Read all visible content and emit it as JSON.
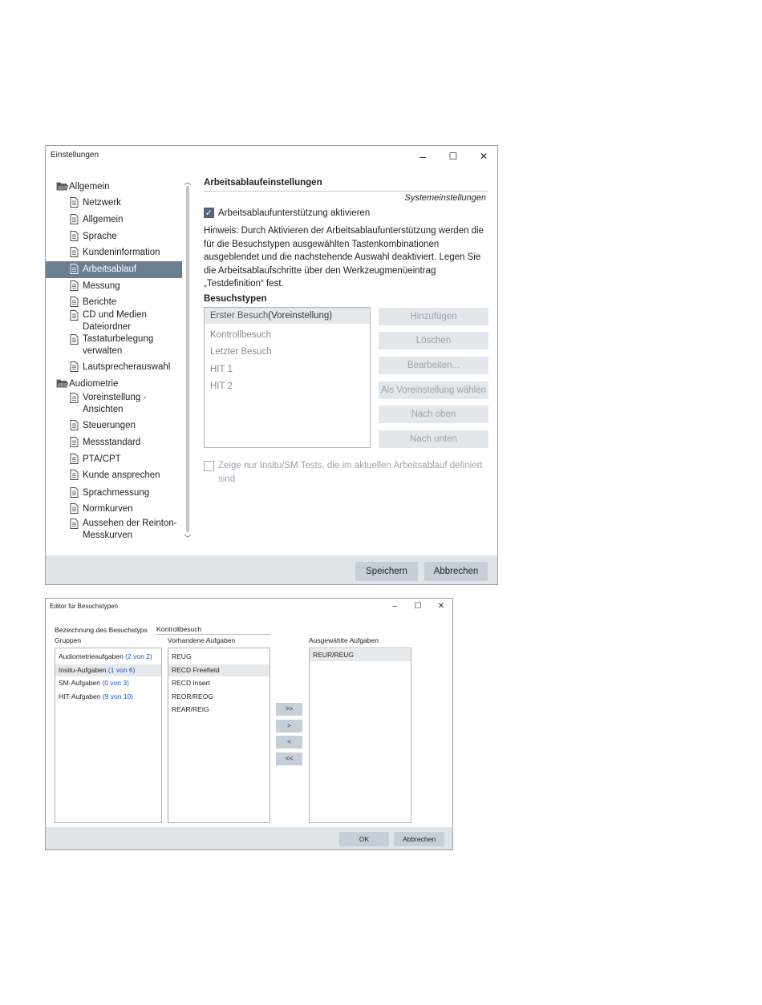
{
  "settings": {
    "title": "Einstellungen",
    "controls": {
      "minimize": "–",
      "maximize": "☐",
      "close": "✕"
    },
    "tree": [
      {
        "label": "Allgemein",
        "type": "folder",
        "depth": 0
      },
      {
        "label": "Netzwerk",
        "type": "page",
        "depth": 1
      },
      {
        "label": "Allgemein",
        "type": "page",
        "depth": 1
      },
      {
        "label": "Sprache",
        "type": "page",
        "depth": 1
      },
      {
        "label": "Kundeninformation",
        "type": "page",
        "depth": 1
      },
      {
        "label": "Arbeitsablauf",
        "type": "page",
        "depth": 1,
        "selected": true
      },
      {
        "label": "Messung",
        "type": "page",
        "depth": 1
      },
      {
        "label": "Berichte",
        "type": "page",
        "depth": 1
      },
      {
        "label": "CD und Medien",
        "label2": "Dateiordner",
        "type": "page",
        "depth": 1
      },
      {
        "label": "Tastaturbelegung",
        "label2": "verwalten",
        "type": "page",
        "depth": 1
      },
      {
        "label": "Lautsprecherauswahl",
        "type": "page",
        "depth": 1
      },
      {
        "label": "Audiometrie",
        "type": "folder",
        "depth": 0
      },
      {
        "label": "Voreinstellung -",
        "label2": "Ansichten",
        "type": "page",
        "depth": 1
      },
      {
        "label": "Steuerungen",
        "type": "page",
        "depth": 1
      },
      {
        "label": "Messstandard",
        "type": "page",
        "depth": 1
      },
      {
        "label": "PTA/CPT",
        "type": "page",
        "depth": 1
      },
      {
        "label": "Kunde ansprechen",
        "type": "page",
        "depth": 1
      },
      {
        "label": "Sprachmessung",
        "type": "page",
        "depth": 1
      },
      {
        "label": "Normkurven",
        "type": "page",
        "depth": 1
      },
      {
        "label": "Aussehen der Reinton-",
        "label2": "Messkurven",
        "type": "page",
        "depth": 1
      }
    ],
    "panel": {
      "heading": "Arbeitsablaufeinstellungen",
      "subheading": "Systemeinstellungen",
      "enable_checkbox": {
        "label": "Arbeitsablaufunterstützung aktivieren",
        "checked": true
      },
      "hint_lines": [
        "Hinweis: Durch Aktivieren der Arbeitsablaufunterstützung werden die",
        "für die Besuchstypen ausgewählten Tastenkombinationen",
        "ausgeblendet und die nachstehende Auswahl deaktiviert. Legen Sie",
        "die Arbeitsablaufschritte über den Werkzeugmenüeintrag",
        "„Testdefinition“ fest."
      ],
      "visit_types_label": "Besuchstypen",
      "visit_types": [
        "Erster Besuch",
        "Kontrollbesuch",
        "Letzter Besuch",
        "HIT 1",
        "HIT 2"
      ],
      "default_suffix": "(Voreinstellung)",
      "buttons": [
        "Hinzufügen",
        "Löschen",
        "Bearbeiten...",
        "Als Voreinstellung wählen",
        "Nach oben",
        "Nach unten"
      ],
      "insitu_checkbox": {
        "line1": "Zeige nur Insitu/SM Tests, die im aktuellen Arbeitsablauf definiert",
        "line2": "sind",
        "checked": false
      }
    },
    "footer": {
      "save": "Speichern",
      "cancel": "Abbrechen"
    }
  },
  "editor": {
    "title": "Editor für Besuchstypen",
    "controls": {
      "minimize": "–",
      "maximize": "☐",
      "close": "✕"
    },
    "name_label": "Bezeichnung des Besuchstyps",
    "name_value": "Kontrollbesuch",
    "groups_label": "Gruppen",
    "groups": [
      {
        "name": "Audiometrieaufgaben",
        "count": "(2 von 2)"
      },
      {
        "name": "Insitu-Aufgaben",
        "count": "(1 von 6)",
        "selected": true
      },
      {
        "name": "SM-Aufgaben",
        "count": "(0 von 3)"
      },
      {
        "name": "HIT-Aufgaben",
        "count": "(9 von 10)"
      }
    ],
    "available_label": "Vorhandene Aufgaben",
    "available": [
      "REUG",
      "RECD Freefield",
      "RECD Insert",
      "REOR/REOG",
      "REAR/REIG"
    ],
    "available_selected": 1,
    "selected_label": "Ausgewählte Aufgaben",
    "selected": [
      "REUR/REUG"
    ],
    "move_buttons": [
      ">>",
      ">",
      "<",
      "<<"
    ],
    "footer": {
      "ok": "OK",
      "cancel": "Abbrechen"
    },
    "colors": {
      "count_blue": "#1a56c8"
    }
  }
}
